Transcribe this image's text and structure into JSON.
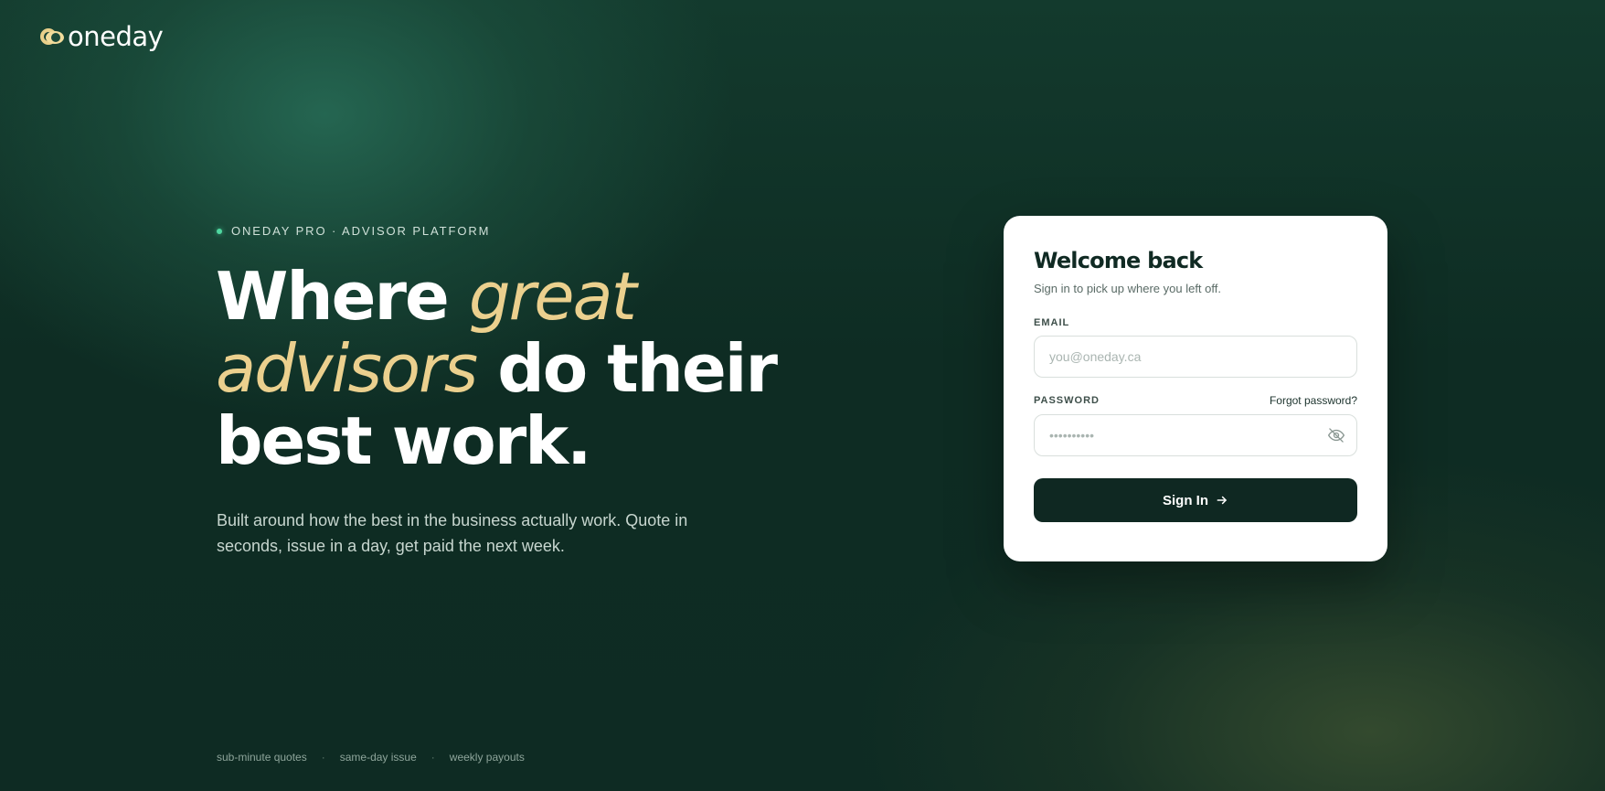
{
  "brand": {
    "name": "oneday",
    "accent_color": "#ebd08e",
    "dark_color": "#0f2822"
  },
  "hero": {
    "eyebrow": "ONEDAY PRO · ADVISOR PLATFORM",
    "headline_part1": "Where ",
    "headline_accent1": "great",
    "headline_accent2": "advisors",
    "headline_part2": " do their",
    "headline_part3": "best work.",
    "subtext": "Built around how the best in the business actually work. Quote in seconds, issue in a day, get paid the next week."
  },
  "footer": {
    "tags": [
      "sub-minute quotes",
      "same-day issue",
      "weekly payouts"
    ],
    "separator": "·"
  },
  "login": {
    "title": "Welcome back",
    "subtitle": "Sign in to pick up where you left off.",
    "email_label": "EMAIL",
    "email_placeholder": "you@oneday.ca",
    "email_value": "",
    "password_label": "PASSWORD",
    "password_placeholder": "••••••••••",
    "password_value": "",
    "forgot_label": "Forgot password?",
    "submit_label": "Sign In",
    "toggle_icon": "eye-off-icon",
    "submit_icon": "arrow-right-icon"
  }
}
